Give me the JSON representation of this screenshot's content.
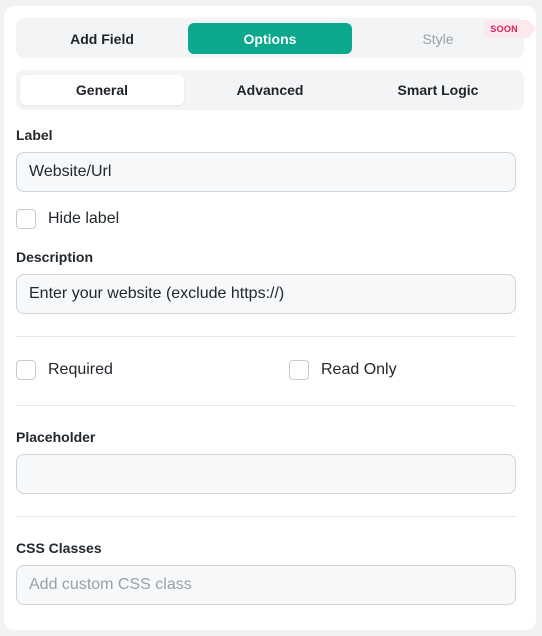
{
  "top_tabs": {
    "add_field": "Add Field",
    "options": "Options",
    "style": "Style",
    "soon_badge": "SOON"
  },
  "sub_tabs": {
    "general": "General",
    "advanced": "Advanced",
    "smart_logic": "Smart Logic"
  },
  "label_field": {
    "label": "Label",
    "value": "Website/Url"
  },
  "hide_label": {
    "label": "Hide label",
    "checked": false
  },
  "description_field": {
    "label": "Description",
    "value": "Enter your website (exclude https://)"
  },
  "required": {
    "label": "Required",
    "checked": false
  },
  "read_only": {
    "label": "Read Only",
    "checked": false
  },
  "placeholder_field": {
    "label": "Placeholder",
    "value": ""
  },
  "css_classes_field": {
    "label": "CSS Classes",
    "placeholder": "Add custom CSS class",
    "value": ""
  },
  "colors": {
    "accent": "#0ca88d",
    "soon_text": "#d6245a",
    "soon_bg": "#fde8ee"
  }
}
